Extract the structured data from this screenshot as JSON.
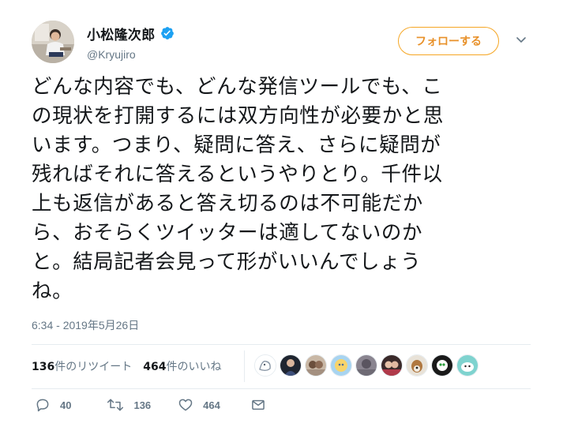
{
  "author": {
    "display_name": "小松隆次郎",
    "username": "@Kryujiro",
    "verified": true
  },
  "follow_button_label": "フォローする",
  "tweet": {
    "lines": [
      "どんな内容でも、どんな発信ツールでも、こ",
      "の現状を打開するには双方向性が必要かと思",
      "います。つまり、疑問に答え、さらに疑問が",
      "残ればそれに答えるというやりとり。千件以",
      "上も返信があると答え切るのは不可能だか",
      "ら、おそらくツイッターは適してないのか",
      "と。結局記者会見って形がいいんでしょう",
      "ね。"
    ],
    "timestamp": "6:34 - 2019年5月26日"
  },
  "stats": {
    "retweets_count": "136",
    "retweets_label": "件のリツイート",
    "likes_count": "464",
    "likes_label": "件のいいね"
  },
  "actions": {
    "reply_count": "40",
    "retweet_count": "136",
    "like_count": "464"
  },
  "colors": {
    "follow_accent": "#f5a623",
    "verified_blue": "#1da1f2",
    "secondary_text": "#657786",
    "primary_text": "#14171a"
  }
}
